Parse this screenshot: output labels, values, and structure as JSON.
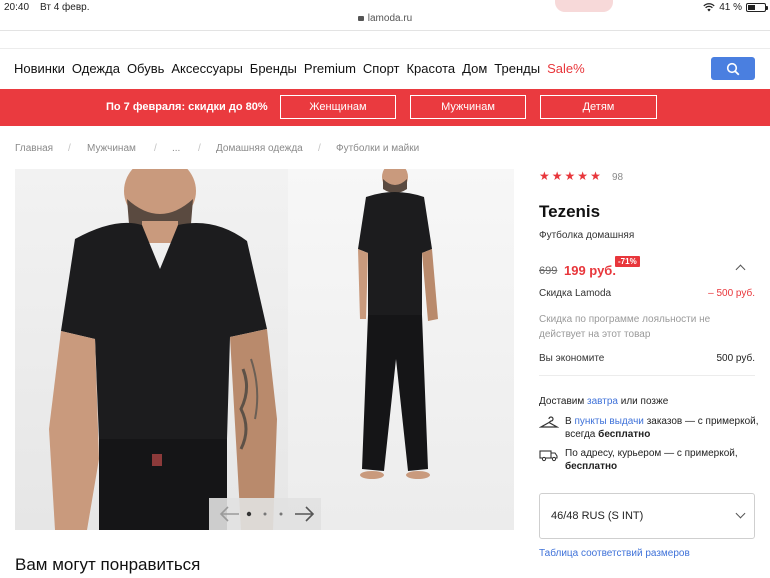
{
  "statusbar": {
    "time": "20:40",
    "date": "Вт 4 февр.",
    "battery": "41 %",
    "battery_level": 0.41
  },
  "browser": {
    "url": "lamoda.ru"
  },
  "nav": {
    "items": [
      "Новинки",
      "Одежда",
      "Обувь",
      "Аксессуары",
      "Бренды",
      "Premium",
      "Спорт",
      "Красота",
      "Дом",
      "Тренды",
      "Sale%"
    ],
    "search_icon": "search-icon"
  },
  "promo": {
    "text": "По 7 февраля: скидки до 80%",
    "buttons": [
      "Женщинам",
      "Мужчинам",
      "Детям"
    ]
  },
  "breadcrumb": {
    "items": [
      "Главная",
      "Мужчинам",
      "...",
      "Домашняя одежда",
      "Футболки и майки"
    ],
    "separator": "/"
  },
  "gallery": {
    "slide_count": 3,
    "active_slide": 1,
    "prev_icon": "arrow-left-icon",
    "next_icon": "arrow-right-icon"
  },
  "product": {
    "rating": 5,
    "rating_count": "98",
    "brand": "Tezenis",
    "name": "Футболка домашняя",
    "old_price": "699",
    "new_price": "199 руб.",
    "discount_badge": "-71%",
    "lamoda_discount_label": "Скидка Lamoda",
    "lamoda_discount_value": "– 500 руб.",
    "loyalty_note": "Скидка по программе лояльности не действует на этот товар",
    "savings_label": "Вы экономите",
    "savings_value": "500 руб."
  },
  "delivery": {
    "prefix": "Доставим",
    "link": "завтра",
    "suffix": "или позже",
    "pickup_prefix": "В",
    "pickup_link": "пункты выдачи",
    "pickup_text": "заказов — с примеркой, всегда",
    "pickup_free": "бесплатно",
    "courier_text": "По адресу, курьером — с примеркой,",
    "courier_free": "бесплатно"
  },
  "size": {
    "selected": "46/48 RUS (S INT)",
    "table_link": "Таблица соответствий размеров"
  },
  "recommendations": {
    "title": "Вам могут понравиться"
  },
  "colors": {
    "accent": "#e8363b",
    "link": "#3f72d9",
    "search": "#4a7fe0"
  }
}
